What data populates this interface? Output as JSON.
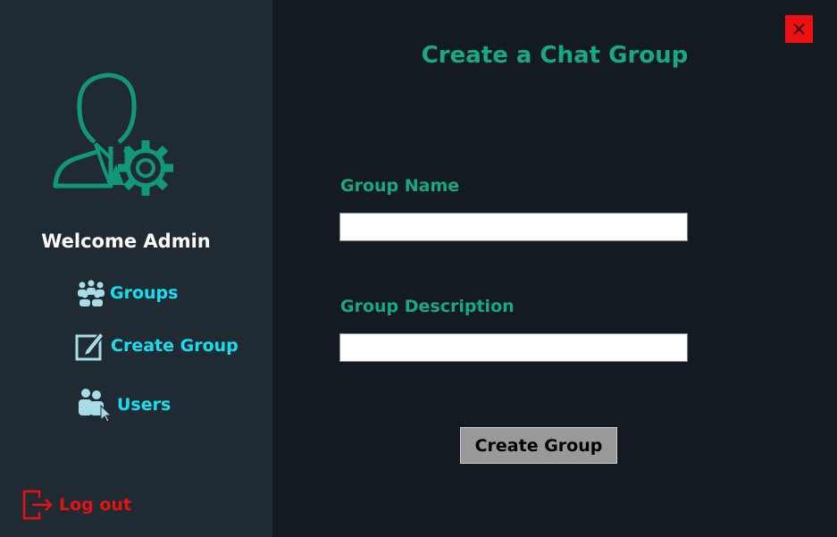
{
  "sidebar": {
    "avatar_icon": "admin-user-gear-icon",
    "welcome_text": "Welcome Admin",
    "nav": [
      {
        "label": "Groups",
        "icon": "groups-icon"
      },
      {
        "label": "Create Group",
        "icon": "create-edit-icon"
      },
      {
        "label": "Users",
        "icon": "users-icon"
      }
    ],
    "logout": {
      "label": "Log out",
      "icon": "logout-icon"
    }
  },
  "window": {
    "close_icon": "close-icon"
  },
  "main": {
    "title": "Create a Chat Group",
    "fields": [
      {
        "label": "Group Name",
        "value": "",
        "placeholder": ""
      },
      {
        "label": "Group Description",
        "value": "",
        "placeholder": ""
      }
    ],
    "submit_label": "Create Group"
  },
  "colors": {
    "sidebar_bg": "#202a32",
    "main_bg": "#131a21",
    "accent_green": "#17a980",
    "nav_cyan": "#16e0f0",
    "danger_red": "#e51212"
  }
}
